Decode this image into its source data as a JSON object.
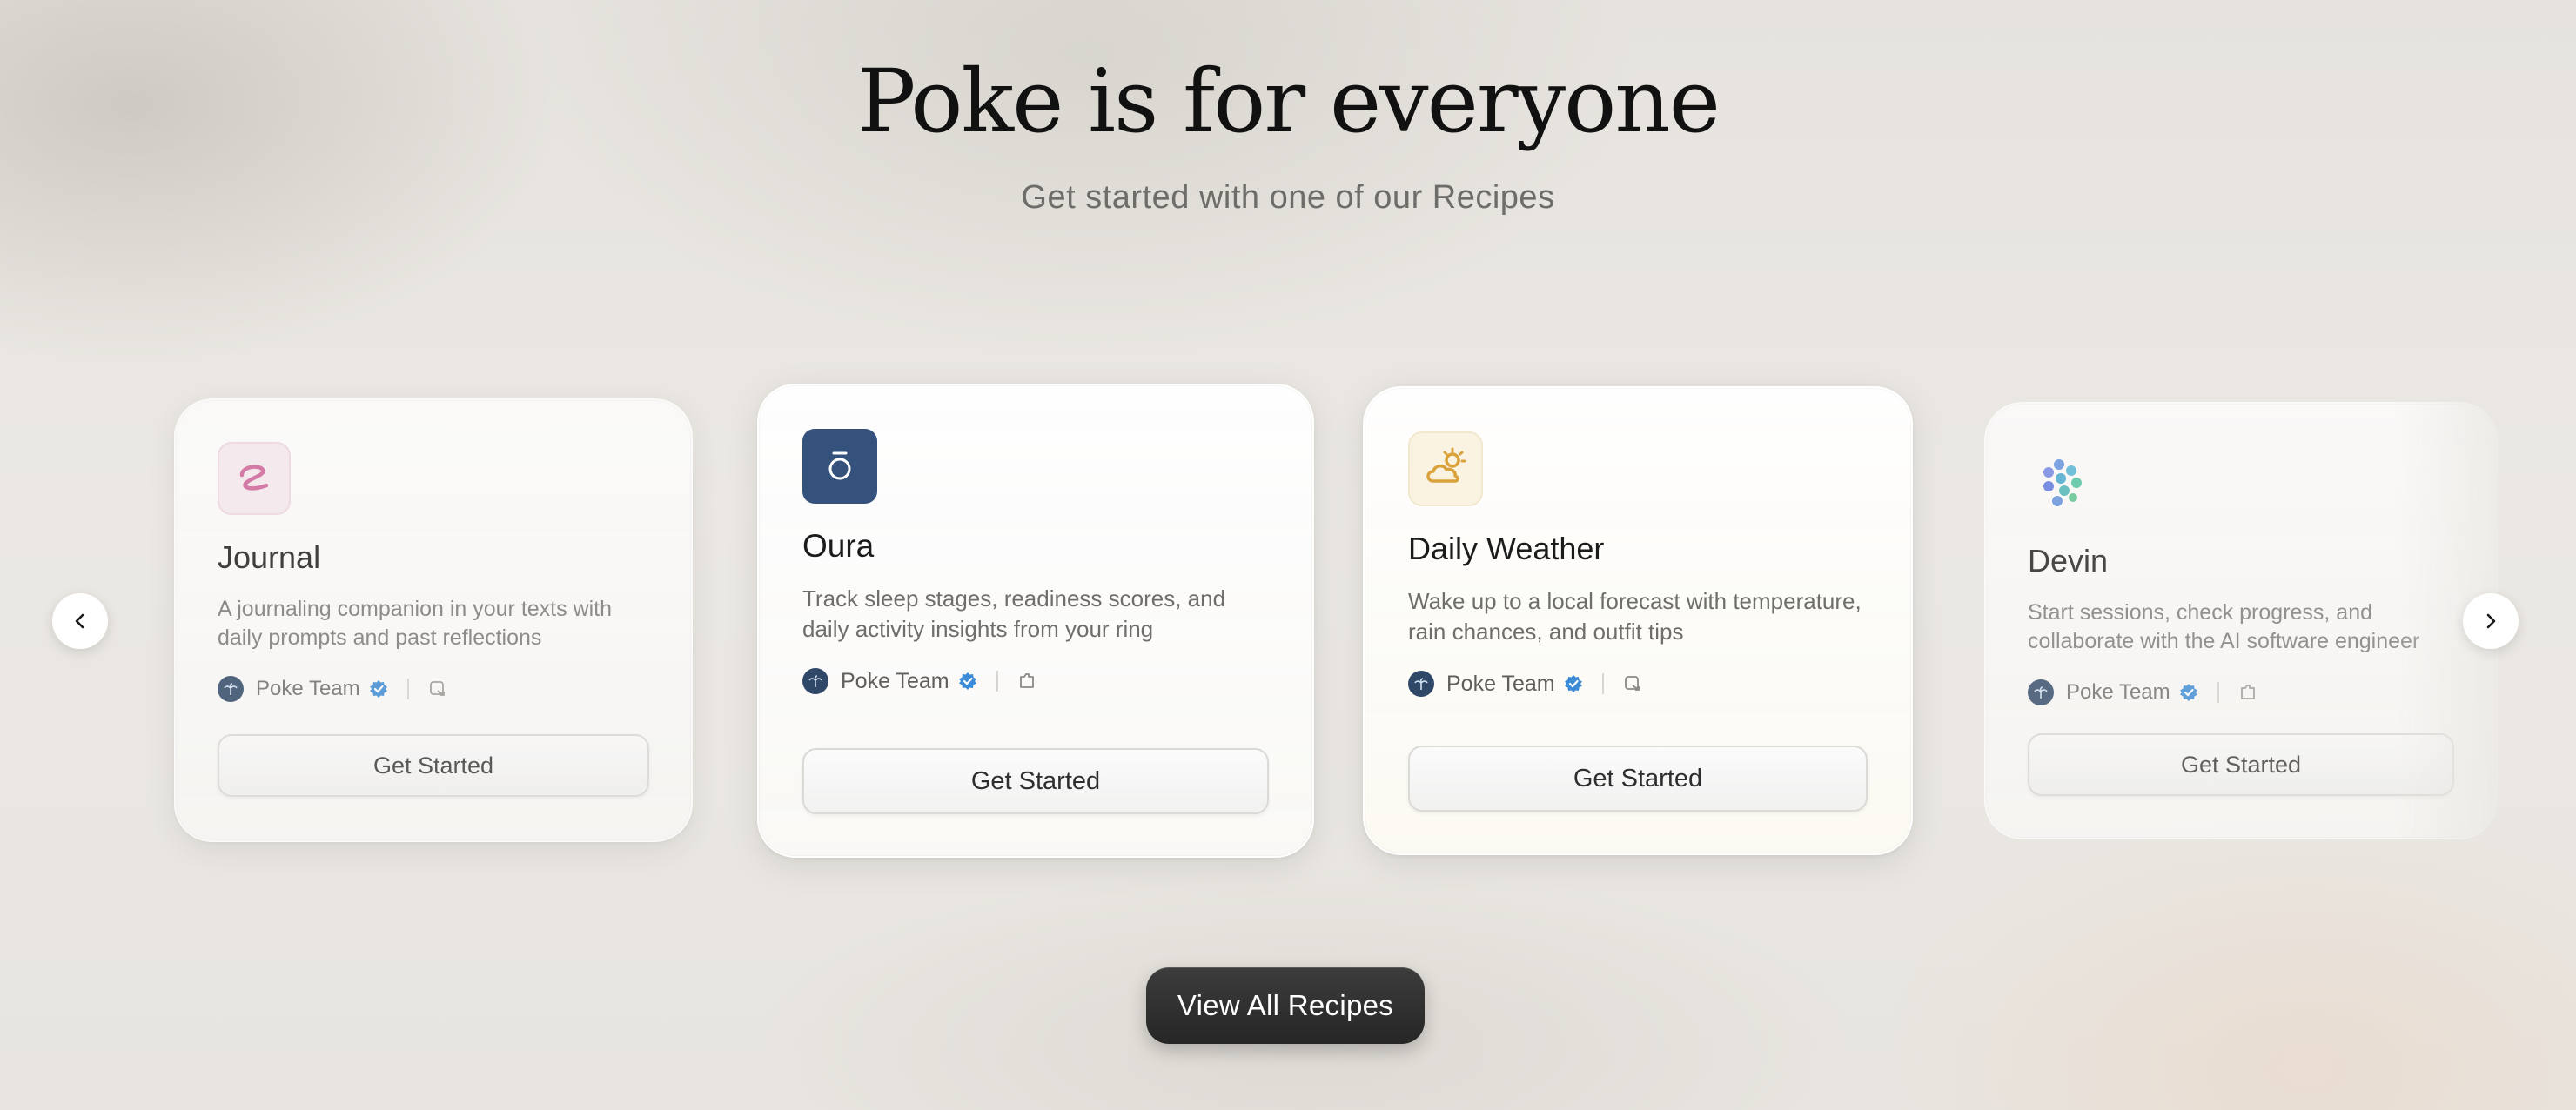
{
  "header": {
    "title": "Poke is for everyone",
    "subtitle": "Get started with one of our Recipes"
  },
  "cards": [
    {
      "title": "Journal",
      "description": "A journaling companion in your texts with daily prompts and past reflections",
      "author": "Poke Team",
      "icon": "journal-icon",
      "button": "Get Started"
    },
    {
      "title": "Oura",
      "description": "Track sleep stages, readiness scores, and daily activity insights from your ring",
      "author": "Poke Team",
      "icon": "oura-ring-icon",
      "button": "Get Started"
    },
    {
      "title": "Daily Weather",
      "description": "Wake up to a local forecast with temperature, rain chances, and outfit tips",
      "author": "Poke Team",
      "icon": "weather-icon",
      "button": "Get Started"
    },
    {
      "title": "Devin",
      "description": "Start sessions, check progress, and collaborate with the AI software engineer",
      "author": "Poke Team",
      "icon": "devin-icon",
      "button": "Get Started"
    }
  ],
  "carousel": {
    "prev_icon": "chevron-left-icon",
    "next_icon": "chevron-right-icon"
  },
  "footer": {
    "view_all": "View All Recipes"
  },
  "colors": {
    "accent_dark": "#2b2b2b",
    "verified_blue": "#3b8bd6",
    "journal_pink": "#d0629a",
    "oura_navy": "#35527d",
    "weather_gold": "#d9a23a"
  }
}
